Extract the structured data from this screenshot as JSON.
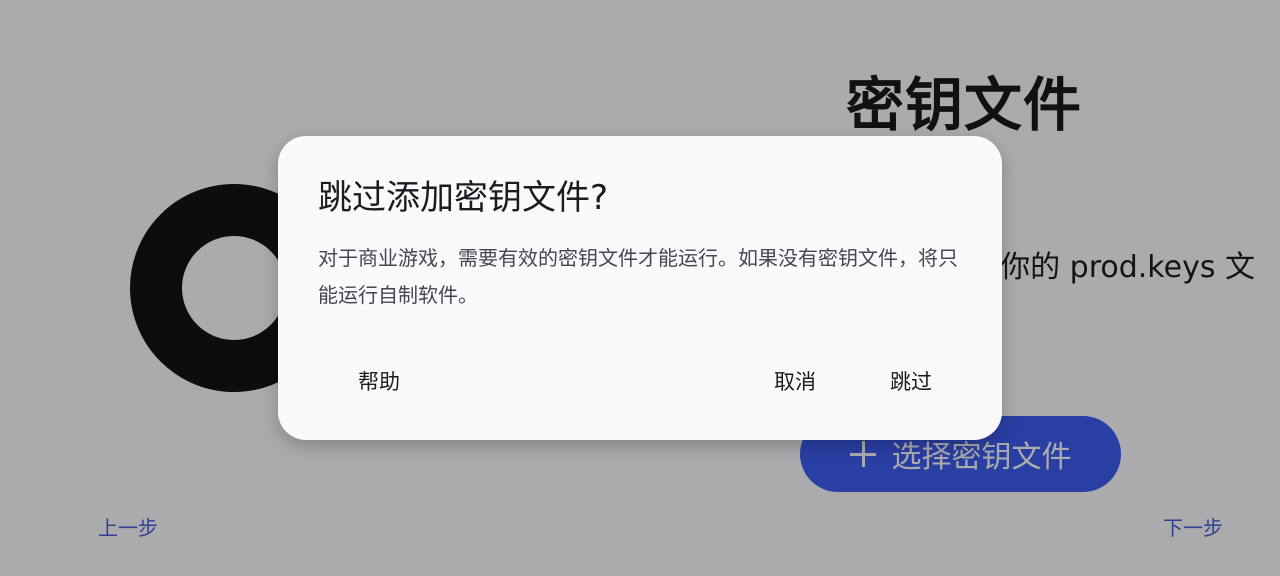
{
  "page": {
    "title": "密钥文件",
    "description": "你的 prod.keys 文",
    "select_button_label": "选择密钥文件",
    "prev_label": "上一步",
    "next_label": "下一步"
  },
  "dialog": {
    "title": "跳过添加密钥文件?",
    "message": "对于商业游戏，需要有效的密钥文件才能运行。如果没有密钥文件，将只能运行自制软件。",
    "help_label": "帮助",
    "cancel_label": "取消",
    "skip_label": "跳过"
  },
  "colors": {
    "accent": "#3f5ef0",
    "scrim": "#a9a7ab",
    "dialog_surface": "#fcf9fd"
  },
  "icons": {
    "key": "key-ring-icon",
    "plus": "plus-icon"
  }
}
